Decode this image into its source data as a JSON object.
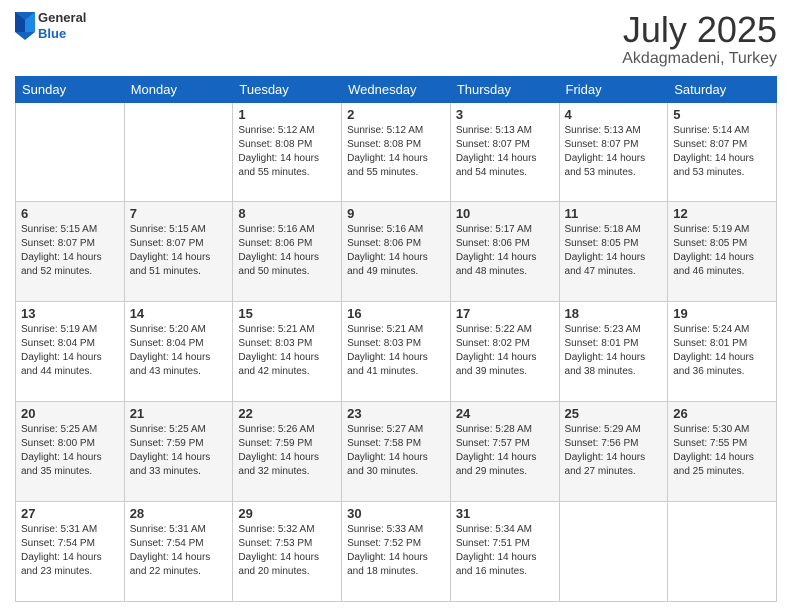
{
  "header": {
    "logo_general": "General",
    "logo_blue": "Blue",
    "title": "July 2025",
    "subtitle": "Akdagmadeni, Turkey"
  },
  "days_of_week": [
    "Sunday",
    "Monday",
    "Tuesday",
    "Wednesday",
    "Thursday",
    "Friday",
    "Saturday"
  ],
  "weeks": [
    [
      {
        "num": "",
        "info": ""
      },
      {
        "num": "",
        "info": ""
      },
      {
        "num": "1",
        "info": "Sunrise: 5:12 AM\nSunset: 8:08 PM\nDaylight: 14 hours and 55 minutes."
      },
      {
        "num": "2",
        "info": "Sunrise: 5:12 AM\nSunset: 8:08 PM\nDaylight: 14 hours and 55 minutes."
      },
      {
        "num": "3",
        "info": "Sunrise: 5:13 AM\nSunset: 8:07 PM\nDaylight: 14 hours and 54 minutes."
      },
      {
        "num": "4",
        "info": "Sunrise: 5:13 AM\nSunset: 8:07 PM\nDaylight: 14 hours and 53 minutes."
      },
      {
        "num": "5",
        "info": "Sunrise: 5:14 AM\nSunset: 8:07 PM\nDaylight: 14 hours and 53 minutes."
      }
    ],
    [
      {
        "num": "6",
        "info": "Sunrise: 5:15 AM\nSunset: 8:07 PM\nDaylight: 14 hours and 52 minutes."
      },
      {
        "num": "7",
        "info": "Sunrise: 5:15 AM\nSunset: 8:07 PM\nDaylight: 14 hours and 51 minutes."
      },
      {
        "num": "8",
        "info": "Sunrise: 5:16 AM\nSunset: 8:06 PM\nDaylight: 14 hours and 50 minutes."
      },
      {
        "num": "9",
        "info": "Sunrise: 5:16 AM\nSunset: 8:06 PM\nDaylight: 14 hours and 49 minutes."
      },
      {
        "num": "10",
        "info": "Sunrise: 5:17 AM\nSunset: 8:06 PM\nDaylight: 14 hours and 48 minutes."
      },
      {
        "num": "11",
        "info": "Sunrise: 5:18 AM\nSunset: 8:05 PM\nDaylight: 14 hours and 47 minutes."
      },
      {
        "num": "12",
        "info": "Sunrise: 5:19 AM\nSunset: 8:05 PM\nDaylight: 14 hours and 46 minutes."
      }
    ],
    [
      {
        "num": "13",
        "info": "Sunrise: 5:19 AM\nSunset: 8:04 PM\nDaylight: 14 hours and 44 minutes."
      },
      {
        "num": "14",
        "info": "Sunrise: 5:20 AM\nSunset: 8:04 PM\nDaylight: 14 hours and 43 minutes."
      },
      {
        "num": "15",
        "info": "Sunrise: 5:21 AM\nSunset: 8:03 PM\nDaylight: 14 hours and 42 minutes."
      },
      {
        "num": "16",
        "info": "Sunrise: 5:21 AM\nSunset: 8:03 PM\nDaylight: 14 hours and 41 minutes."
      },
      {
        "num": "17",
        "info": "Sunrise: 5:22 AM\nSunset: 8:02 PM\nDaylight: 14 hours and 39 minutes."
      },
      {
        "num": "18",
        "info": "Sunrise: 5:23 AM\nSunset: 8:01 PM\nDaylight: 14 hours and 38 minutes."
      },
      {
        "num": "19",
        "info": "Sunrise: 5:24 AM\nSunset: 8:01 PM\nDaylight: 14 hours and 36 minutes."
      }
    ],
    [
      {
        "num": "20",
        "info": "Sunrise: 5:25 AM\nSunset: 8:00 PM\nDaylight: 14 hours and 35 minutes."
      },
      {
        "num": "21",
        "info": "Sunrise: 5:25 AM\nSunset: 7:59 PM\nDaylight: 14 hours and 33 minutes."
      },
      {
        "num": "22",
        "info": "Sunrise: 5:26 AM\nSunset: 7:59 PM\nDaylight: 14 hours and 32 minutes."
      },
      {
        "num": "23",
        "info": "Sunrise: 5:27 AM\nSunset: 7:58 PM\nDaylight: 14 hours and 30 minutes."
      },
      {
        "num": "24",
        "info": "Sunrise: 5:28 AM\nSunset: 7:57 PM\nDaylight: 14 hours and 29 minutes."
      },
      {
        "num": "25",
        "info": "Sunrise: 5:29 AM\nSunset: 7:56 PM\nDaylight: 14 hours and 27 minutes."
      },
      {
        "num": "26",
        "info": "Sunrise: 5:30 AM\nSunset: 7:55 PM\nDaylight: 14 hours and 25 minutes."
      }
    ],
    [
      {
        "num": "27",
        "info": "Sunrise: 5:31 AM\nSunset: 7:54 PM\nDaylight: 14 hours and 23 minutes."
      },
      {
        "num": "28",
        "info": "Sunrise: 5:31 AM\nSunset: 7:54 PM\nDaylight: 14 hours and 22 minutes."
      },
      {
        "num": "29",
        "info": "Sunrise: 5:32 AM\nSunset: 7:53 PM\nDaylight: 14 hours and 20 minutes."
      },
      {
        "num": "30",
        "info": "Sunrise: 5:33 AM\nSunset: 7:52 PM\nDaylight: 14 hours and 18 minutes."
      },
      {
        "num": "31",
        "info": "Sunrise: 5:34 AM\nSunset: 7:51 PM\nDaylight: 14 hours and 16 minutes."
      },
      {
        "num": "",
        "info": ""
      },
      {
        "num": "",
        "info": ""
      }
    ]
  ]
}
